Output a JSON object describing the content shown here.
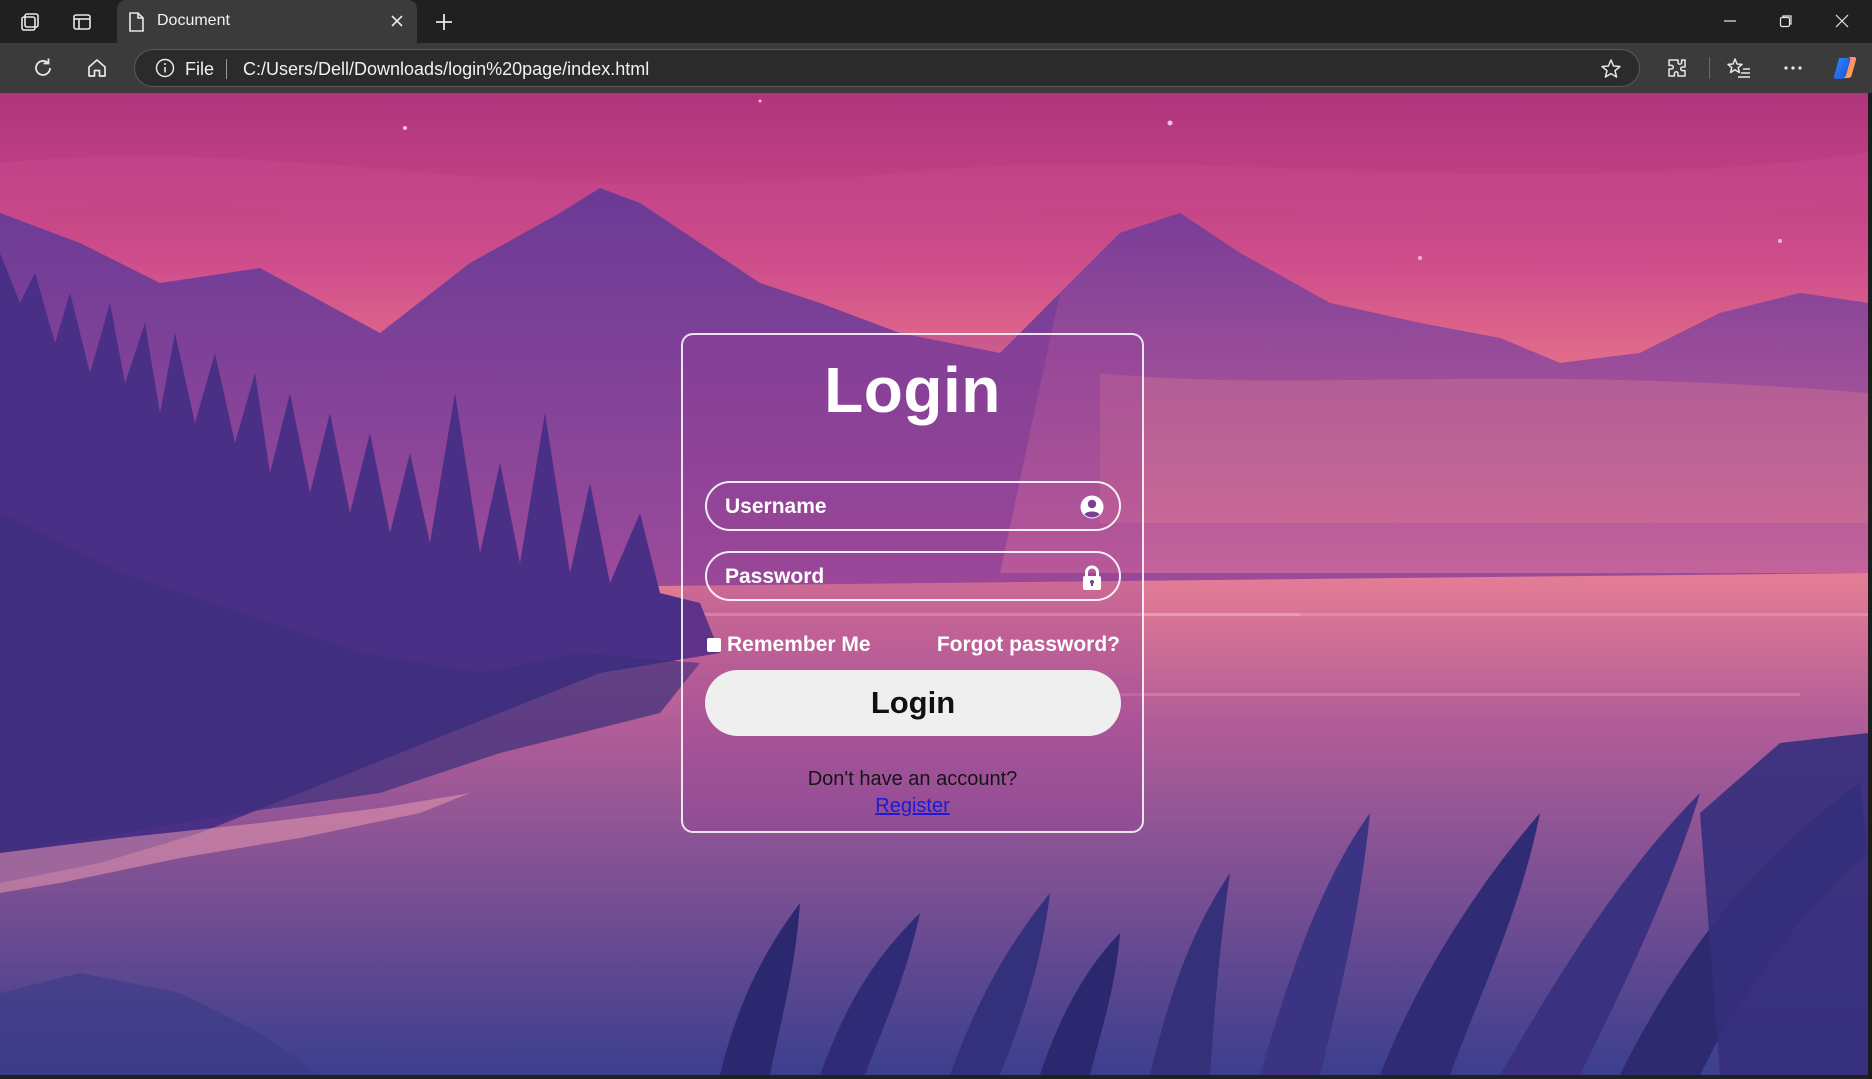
{
  "browser": {
    "tab_title": "Document",
    "address_scheme_label": "File",
    "url": "C:/Users/Dell/Downloads/login%20page/index.html"
  },
  "login": {
    "title": "Login",
    "username_placeholder": "Username",
    "password_placeholder": "Password",
    "remember_label": "Remember Me",
    "forgot_label": "Forgot password?",
    "submit_label": "Login",
    "no_account_text": "Don't have an account?",
    "register_label": "Register"
  },
  "icons": {
    "username": "user-circle-icon",
    "password": "lock-icon"
  },
  "colors": {
    "register_link": "#1a1ad8",
    "button_bg": "#efefef",
    "tab_bg": "#3b3b3b",
    "chrome_bg": "#202020"
  }
}
